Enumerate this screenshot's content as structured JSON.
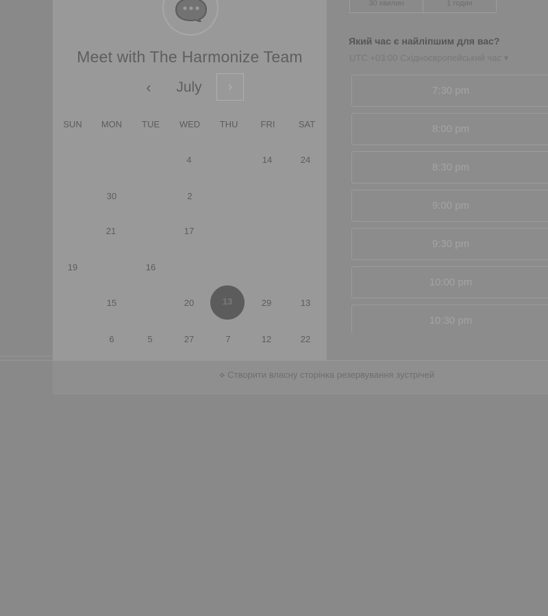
{
  "calendar": {
    "title": "Meet with The Harmonize Team",
    "month": "July",
    "prev_glyph": "‹",
    "next_glyph": "›",
    "weekdays": [
      "SUN",
      "MON",
      "TUE",
      "WED",
      "THU",
      "FRI",
      "SAT"
    ],
    "days": [
      "4",
      "14",
      "24",
      "30",
      "2",
      "21",
      "17",
      "19",
      "16",
      "15",
      "20",
      "29",
      "13",
      "6",
      "5",
      "27",
      "7",
      "12",
      "22"
    ],
    "selected_day": "13"
  },
  "duration": {
    "option_1": "30 хвилин",
    "option_2": "1 годин"
  },
  "time_picker": {
    "question": "Який час є найліпшим для вас?",
    "timezone": "UTC +03:00 Східноєвропейський час ▾",
    "slots": [
      "7:30 pm",
      "8:00 pm",
      "8:30 pm",
      "9:00 pm",
      "9:30 pm",
      "10:00 pm",
      "10:30 pm"
    ]
  },
  "footer": {
    "link": "Створити власну сторінка резервування зустрічей"
  },
  "icons": {
    "avatar": "chat-bubble-icon",
    "footer": "hubspot-sprocket-icon"
  },
  "colors": {
    "overlay_bg": "#898989",
    "card_bg": "#999999",
    "selected_day_bg": "#5c5c5c"
  }
}
